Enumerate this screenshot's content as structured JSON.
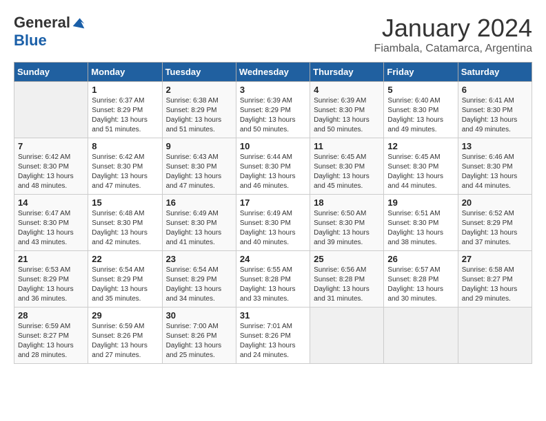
{
  "header": {
    "logo_general": "General",
    "logo_blue": "Blue",
    "title": "January 2024",
    "subtitle": "Fiambala, Catamarca, Argentina"
  },
  "days_of_week": [
    "Sunday",
    "Monday",
    "Tuesday",
    "Wednesday",
    "Thursday",
    "Friday",
    "Saturday"
  ],
  "weeks": [
    [
      {
        "num": "",
        "info": ""
      },
      {
        "num": "1",
        "info": "Sunrise: 6:37 AM\nSunset: 8:29 PM\nDaylight: 13 hours\nand 51 minutes."
      },
      {
        "num": "2",
        "info": "Sunrise: 6:38 AM\nSunset: 8:29 PM\nDaylight: 13 hours\nand 51 minutes."
      },
      {
        "num": "3",
        "info": "Sunrise: 6:39 AM\nSunset: 8:29 PM\nDaylight: 13 hours\nand 50 minutes."
      },
      {
        "num": "4",
        "info": "Sunrise: 6:39 AM\nSunset: 8:30 PM\nDaylight: 13 hours\nand 50 minutes."
      },
      {
        "num": "5",
        "info": "Sunrise: 6:40 AM\nSunset: 8:30 PM\nDaylight: 13 hours\nand 49 minutes."
      },
      {
        "num": "6",
        "info": "Sunrise: 6:41 AM\nSunset: 8:30 PM\nDaylight: 13 hours\nand 49 minutes."
      }
    ],
    [
      {
        "num": "7",
        "info": "Sunrise: 6:42 AM\nSunset: 8:30 PM\nDaylight: 13 hours\nand 48 minutes."
      },
      {
        "num": "8",
        "info": "Sunrise: 6:42 AM\nSunset: 8:30 PM\nDaylight: 13 hours\nand 47 minutes."
      },
      {
        "num": "9",
        "info": "Sunrise: 6:43 AM\nSunset: 8:30 PM\nDaylight: 13 hours\nand 47 minutes."
      },
      {
        "num": "10",
        "info": "Sunrise: 6:44 AM\nSunset: 8:30 PM\nDaylight: 13 hours\nand 46 minutes."
      },
      {
        "num": "11",
        "info": "Sunrise: 6:45 AM\nSunset: 8:30 PM\nDaylight: 13 hours\nand 45 minutes."
      },
      {
        "num": "12",
        "info": "Sunrise: 6:45 AM\nSunset: 8:30 PM\nDaylight: 13 hours\nand 44 minutes."
      },
      {
        "num": "13",
        "info": "Sunrise: 6:46 AM\nSunset: 8:30 PM\nDaylight: 13 hours\nand 44 minutes."
      }
    ],
    [
      {
        "num": "14",
        "info": "Sunrise: 6:47 AM\nSunset: 8:30 PM\nDaylight: 13 hours\nand 43 minutes."
      },
      {
        "num": "15",
        "info": "Sunrise: 6:48 AM\nSunset: 8:30 PM\nDaylight: 13 hours\nand 42 minutes."
      },
      {
        "num": "16",
        "info": "Sunrise: 6:49 AM\nSunset: 8:30 PM\nDaylight: 13 hours\nand 41 minutes."
      },
      {
        "num": "17",
        "info": "Sunrise: 6:49 AM\nSunset: 8:30 PM\nDaylight: 13 hours\nand 40 minutes."
      },
      {
        "num": "18",
        "info": "Sunrise: 6:50 AM\nSunset: 8:30 PM\nDaylight: 13 hours\nand 39 minutes."
      },
      {
        "num": "19",
        "info": "Sunrise: 6:51 AM\nSunset: 8:30 PM\nDaylight: 13 hours\nand 38 minutes."
      },
      {
        "num": "20",
        "info": "Sunrise: 6:52 AM\nSunset: 8:29 PM\nDaylight: 13 hours\nand 37 minutes."
      }
    ],
    [
      {
        "num": "21",
        "info": "Sunrise: 6:53 AM\nSunset: 8:29 PM\nDaylight: 13 hours\nand 36 minutes."
      },
      {
        "num": "22",
        "info": "Sunrise: 6:54 AM\nSunset: 8:29 PM\nDaylight: 13 hours\nand 35 minutes."
      },
      {
        "num": "23",
        "info": "Sunrise: 6:54 AM\nSunset: 8:29 PM\nDaylight: 13 hours\nand 34 minutes."
      },
      {
        "num": "24",
        "info": "Sunrise: 6:55 AM\nSunset: 8:28 PM\nDaylight: 13 hours\nand 33 minutes."
      },
      {
        "num": "25",
        "info": "Sunrise: 6:56 AM\nSunset: 8:28 PM\nDaylight: 13 hours\nand 31 minutes."
      },
      {
        "num": "26",
        "info": "Sunrise: 6:57 AM\nSunset: 8:28 PM\nDaylight: 13 hours\nand 30 minutes."
      },
      {
        "num": "27",
        "info": "Sunrise: 6:58 AM\nSunset: 8:27 PM\nDaylight: 13 hours\nand 29 minutes."
      }
    ],
    [
      {
        "num": "28",
        "info": "Sunrise: 6:59 AM\nSunset: 8:27 PM\nDaylight: 13 hours\nand 28 minutes."
      },
      {
        "num": "29",
        "info": "Sunrise: 6:59 AM\nSunset: 8:26 PM\nDaylight: 13 hours\nand 27 minutes."
      },
      {
        "num": "30",
        "info": "Sunrise: 7:00 AM\nSunset: 8:26 PM\nDaylight: 13 hours\nand 25 minutes."
      },
      {
        "num": "31",
        "info": "Sunrise: 7:01 AM\nSunset: 8:26 PM\nDaylight: 13 hours\nand 24 minutes."
      },
      {
        "num": "",
        "info": ""
      },
      {
        "num": "",
        "info": ""
      },
      {
        "num": "",
        "info": ""
      }
    ]
  ]
}
